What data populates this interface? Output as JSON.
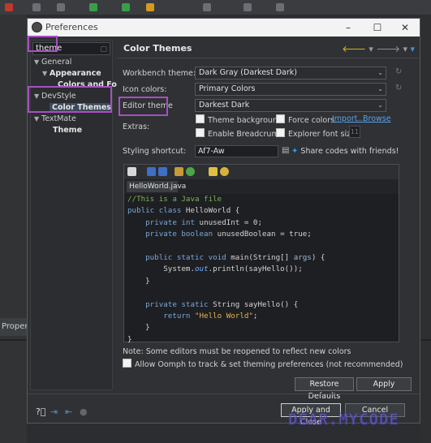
{
  "ide": {
    "properties_label": "Propertie"
  },
  "dialog": {
    "title": "Preferences",
    "window_buttons": [
      "–",
      "☐",
      "✕"
    ]
  },
  "tree": {
    "filter_value": "theme",
    "items": [
      {
        "label": "General",
        "level": 0,
        "expanded": true
      },
      {
        "label": "Appearance",
        "level": 1,
        "expanded": true
      },
      {
        "label": "Colors and Fo",
        "level": 2
      },
      {
        "label": "DevStyle",
        "level": 0,
        "expanded": true
      },
      {
        "label": "Color Themes",
        "level": 1,
        "selected": true
      },
      {
        "label": "TextMate",
        "level": 0,
        "expanded": true
      },
      {
        "label": "Theme",
        "level": 1
      }
    ]
  },
  "page": {
    "title": "Color Themes",
    "workbench_theme_label": "Workbench theme:",
    "workbench_theme_value": "Dark Gray (Darkest Dark)",
    "icon_colors_label": "Icon colors:",
    "icon_colors_value": "Primary Colors",
    "editor_theme_label": "Editor theme",
    "editor_theme_value": "Darkest Dark",
    "extras_label": "Extras:",
    "theme_background": "Theme background",
    "force_colors": "Force colors",
    "import_link": "Import...",
    "browse_link": "Browse",
    "enable_breadcrumb": "Enable Breadcrumb",
    "explorer_font_size": "Explorer font size",
    "explorer_font_size_value": "11",
    "styling_shortcut_label": "Styling shortcut:",
    "styling_shortcut_value": "Af7-Aw",
    "share_codes": "Share codes with friends!"
  },
  "preview": {
    "tab_label": "HelloWorld.java",
    "lines": {
      "l1": "//This is a Java file",
      "l2_kw": "public class",
      "l2_rest": " HelloWorld {",
      "l3_kw": "private int",
      "l3_rest": " unusedInt = 0;",
      "l4_kw": "private boolean",
      "l4_rest": " unusedBoolean = true;",
      "l5_kw": "public static void",
      "l5_rest1": " main(String[] ",
      "l5_param": "args",
      "l5_rest2": ") {",
      "l6_a": "System.",
      "l6_field": "out",
      "l6_b": ".println(sayHello());",
      "l7": "}",
      "l8_kw": "private static",
      "l8_rest": " String sayHello() {",
      "l9_kw": "return",
      "l9_str": " \"Hello World\"",
      "l9_end": ";",
      "l10": "}",
      "l11": "}"
    }
  },
  "notes": {
    "reopen_note": "Note: Some editors must be reopened to reflect new colors",
    "oomph": "Allow Oomph to track & set theming preferences (not recommended)"
  },
  "buttons": {
    "restore_defaults": "Restore Defaults",
    "apply": "Apply",
    "apply_and_close": "Apply and Close",
    "cancel": "Cancel"
  },
  "watermark": "DEAR.MYCODE",
  "colors": {
    "highlight": "#a84fc2",
    "link": "#5aa0ea",
    "comment": "#7ab354",
    "keyword": "#7aa6da",
    "string": "#e6b450"
  }
}
